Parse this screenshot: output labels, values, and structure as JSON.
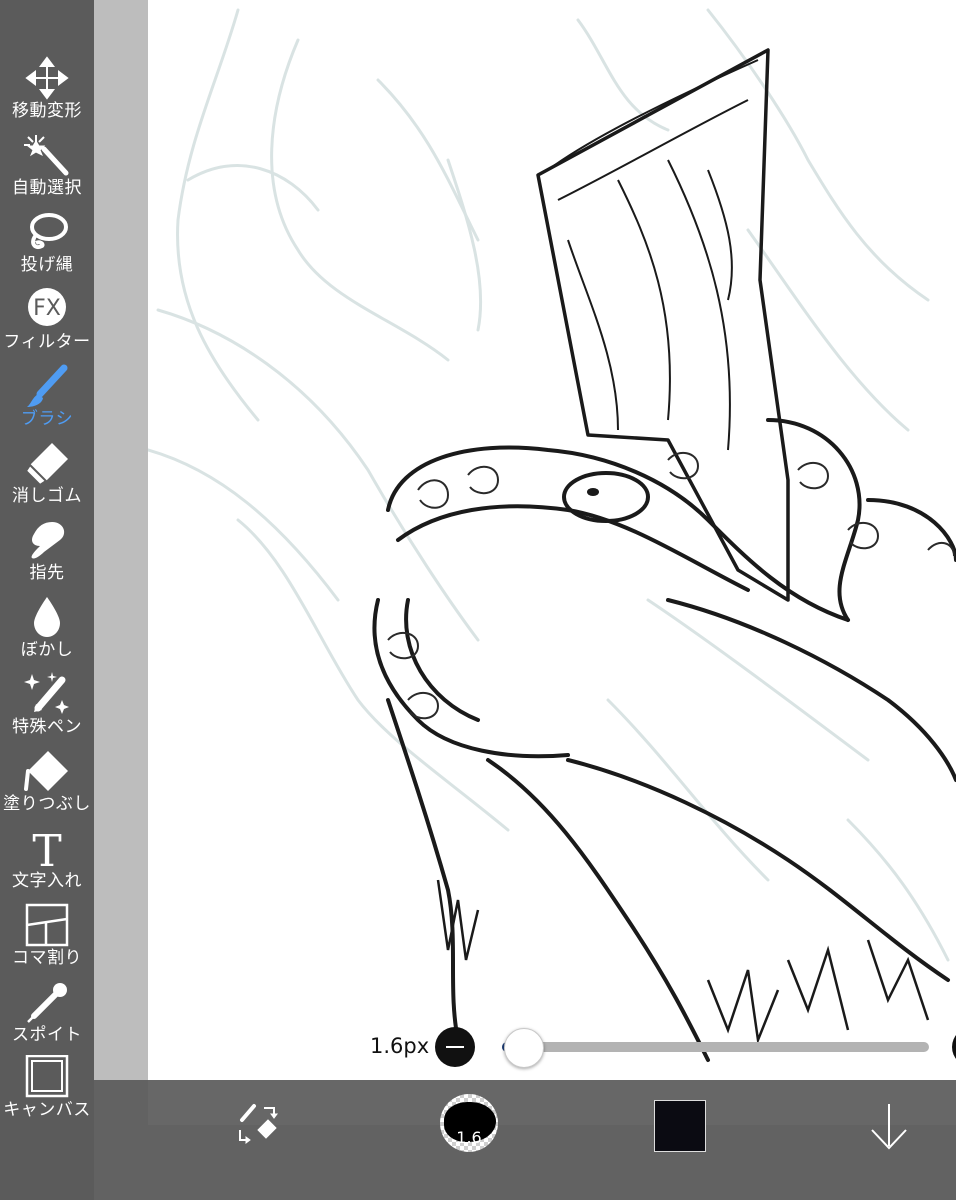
{
  "toolbar": {
    "tools": [
      {
        "label": "移動変形",
        "icon": "move-transform-icon"
      },
      {
        "label": "自動選択",
        "icon": "magic-wand-icon"
      },
      {
        "label": "投げ縄",
        "icon": "lasso-icon"
      },
      {
        "label": "フィルター",
        "icon": "fx-filter-icon",
        "glyph": "FX"
      },
      {
        "label": "ブラシ",
        "icon": "brush-icon",
        "active": true
      },
      {
        "label": "消しゴム",
        "icon": "eraser-icon"
      },
      {
        "label": "指先",
        "icon": "finger-smudge-icon"
      },
      {
        "label": "ぼかし",
        "icon": "blur-drop-icon"
      },
      {
        "label": "特殊ペン",
        "icon": "special-pen-icon"
      },
      {
        "label": "塗りつぶし",
        "icon": "bucket-fill-icon"
      },
      {
        "label": "文字入れ",
        "icon": "text-icon",
        "glyph": "T"
      },
      {
        "label": "コマ割り",
        "icon": "panel-split-icon"
      },
      {
        "label": "スポイト",
        "icon": "eyedropper-icon"
      },
      {
        "label": "キャンバス",
        "icon": "canvas-icon"
      }
    ],
    "active_color": "#4f9cf3"
  },
  "brush_size": {
    "readout": "1.6px",
    "slider_fraction": 0.05,
    "preview_label": "1.6"
  },
  "bottom_bar": {
    "swap_icon": "brush-eraser-swap-icon",
    "current_color": "#0b0b12",
    "download_icon": "arrow-down-icon"
  }
}
